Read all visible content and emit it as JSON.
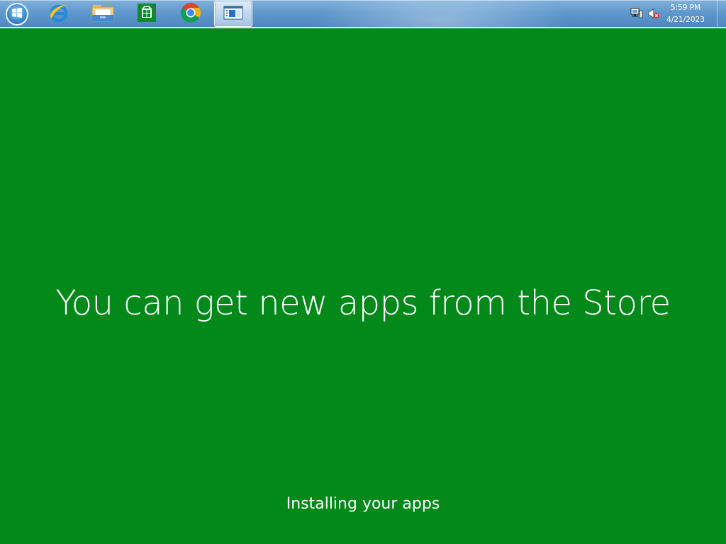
{
  "taskbar": {
    "start_button": {
      "icon": "windows-logo-icon"
    },
    "pinned": [
      {
        "name": "Internet Explorer",
        "icon": "internet-explorer-icon"
      },
      {
        "name": "File Explorer",
        "icon": "file-explorer-icon"
      },
      {
        "name": "Store",
        "icon": "store-icon"
      },
      {
        "name": "Google Chrome",
        "icon": "chrome-icon"
      },
      {
        "name": "Active window",
        "icon": "window-app-icon",
        "active": true
      }
    ],
    "tray": {
      "network_icon": "network-icon",
      "volume_icon": "volume-muted-icon",
      "time": "5:59 PM",
      "date": "4/21/2023"
    }
  },
  "main": {
    "headline": "You can get new apps from the Store",
    "status": "Installing your apps"
  },
  "colors": {
    "background": "#03881a",
    "taskbar": "#5f98cc",
    "text": "#ffffff"
  }
}
